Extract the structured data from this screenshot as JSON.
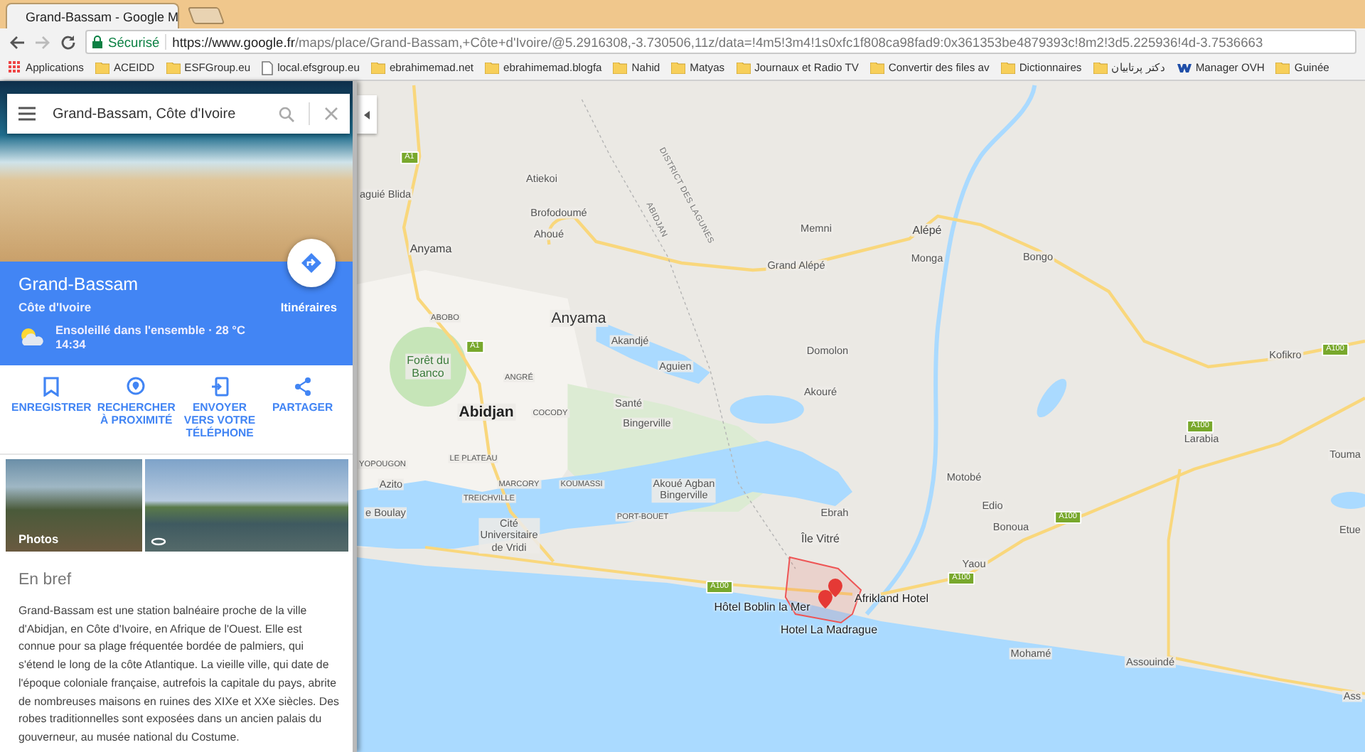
{
  "browser": {
    "tabs": [
      {
        "title": "Grand-Bassam - Google M",
        "selected": true
      }
    ],
    "address_bar": {
      "security_label": "Sécurisé",
      "url_host": "https://www.google.fr",
      "url_path": "/maps/place/Grand-Bassam,+Côte+d'Ivoire/@5.2916308,-3.730506,11z/data=!4m5!3m4!1s0xfc1f808ca98fad9:0x361353be4879393c!8m2!3d5.225936!4d-3.7536663"
    },
    "bookmarks": [
      {
        "label": "Applications",
        "kind": "apps"
      },
      {
        "label": "ACEIDD",
        "kind": "folder"
      },
      {
        "label": "ESFGroup.eu",
        "kind": "folder"
      },
      {
        "label": "local.efsgroup.eu",
        "kind": "page"
      },
      {
        "label": "ebrahimemad.net",
        "kind": "folder"
      },
      {
        "label": "ebrahimemad.blogfa",
        "kind": "folder"
      },
      {
        "label": "Nahid",
        "kind": "folder"
      },
      {
        "label": "Matyas",
        "kind": "folder"
      },
      {
        "label": "Journaux et Radio TV",
        "kind": "folder"
      },
      {
        "label": "Convertir des files av",
        "kind": "folder"
      },
      {
        "label": "Dictionnaires",
        "kind": "folder"
      },
      {
        "label": "دکتر پرتابیان",
        "kind": "folder"
      },
      {
        "label": "Manager OVH",
        "kind": "site"
      },
      {
        "label": "Guinée",
        "kind": "folder"
      }
    ]
  },
  "search": {
    "value": "Grand-Bassam, Côte d'Ivoire"
  },
  "place": {
    "name": "Grand-Bassam",
    "country": "Côte d'Ivoire",
    "weather": "Ensoleillé dans l'ensemble · 28 °C",
    "time": "14:34",
    "directions_label": "Itinéraires"
  },
  "actions": [
    {
      "label": "ENREGISTRER",
      "kind": "save"
    },
    {
      "label": "RECHERCHER À PROXIMITÉ",
      "kind": "nearby"
    },
    {
      "label": "ENVOYER VERS VOTRE TÉLÉPHONE",
      "kind": "send"
    },
    {
      "label": "PARTAGER",
      "kind": "share"
    }
  ],
  "photos": {
    "label": "Photos"
  },
  "summary": {
    "title": "En bref",
    "text": "Grand-Bassam est une station balnéaire proche de la ville d'Abidjan, en Côte d'Ivoire, en Afrique de l'Ouest. Elle est connue pour sa plage fréquentée bordée de palmiers, qui s'étend le long de la côte Atlantique. La vieille ville, qui date de l'époque coloniale française, autrefois la capitale du pays, abrite de nombreuses maisons en ruines des XIXe et XXe siècles. Des robes traditionnelles sont exposées dans un ancien palais du gouverneur, au musée national du Costume."
  },
  "map": {
    "labels": [
      {
        "text": "aguié Blida",
        "kind": "place"
      },
      {
        "text": "Atiekoi",
        "kind": "place"
      },
      {
        "text": "Brofodoumé",
        "kind": "place"
      },
      {
        "text": "Ahoué",
        "kind": "place"
      },
      {
        "text": "DISTRICT DES LAGUNES",
        "kind": "region"
      },
      {
        "text": "ABIDJAN",
        "kind": "region"
      },
      {
        "text": "Memni",
        "kind": "place"
      },
      {
        "text": "Alépé",
        "kind": "town"
      },
      {
        "text": "Grand Alépé",
        "kind": "place"
      },
      {
        "text": "Monga",
        "kind": "place"
      },
      {
        "text": "Bongo",
        "kind": "place"
      },
      {
        "text": "Anyama",
        "kind": "town"
      },
      {
        "text": "ABOBO",
        "kind": "district"
      },
      {
        "text": "Anyama",
        "kind": "city"
      },
      {
        "text": "Forêt du\nBanco",
        "kind": "park"
      },
      {
        "text": "Akandjé",
        "kind": "place"
      },
      {
        "text": "Aguien",
        "kind": "place"
      },
      {
        "text": "Domolon",
        "kind": "place"
      },
      {
        "text": "Akouré",
        "kind": "place"
      },
      {
        "text": "ANGRÉ",
        "kind": "district"
      },
      {
        "text": "Abidjan",
        "kind": "capital"
      },
      {
        "text": "COCODY",
        "kind": "district"
      },
      {
        "text": "Santé",
        "kind": "place"
      },
      {
        "text": "Kofikro",
        "kind": "place"
      },
      {
        "text": "Bingerville",
        "kind": "place"
      },
      {
        "text": "YOPOUGON",
        "kind": "district"
      },
      {
        "text": "LE PLATEAU",
        "kind": "district"
      },
      {
        "text": "Azito",
        "kind": "place"
      },
      {
        "text": "MARCORY",
        "kind": "district"
      },
      {
        "text": "KOUMASSI",
        "kind": "district"
      },
      {
        "text": "TREICHVILLE",
        "kind": "district"
      },
      {
        "text": "Akoué Agban\nBingerville",
        "kind": "place"
      },
      {
        "text": "e Boulay",
        "kind": "place"
      },
      {
        "text": "PORT-BOUET",
        "kind": "district"
      },
      {
        "text": "Cité\nUniversitaire\nde Vridi",
        "kind": "place"
      },
      {
        "text": "Ebrah",
        "kind": "place"
      },
      {
        "text": "Île Vitré",
        "kind": "town"
      },
      {
        "text": "Motobé",
        "kind": "place"
      },
      {
        "text": "Edio",
        "kind": "place"
      },
      {
        "text": "Bonoua",
        "kind": "place"
      },
      {
        "text": "Yaou",
        "kind": "place"
      },
      {
        "text": "Larabia",
        "kind": "place"
      },
      {
        "text": "Touma",
        "kind": "place"
      },
      {
        "text": "Etue",
        "kind": "place"
      },
      {
        "text": "Mohamé",
        "kind": "place"
      },
      {
        "text": "Assouindé",
        "kind": "place"
      },
      {
        "text": "Ass",
        "kind": "place"
      },
      {
        "text": "Hôtel Boblin la Mer",
        "kind": "poi"
      },
      {
        "text": "Afrikland Hotel",
        "kind": "poi"
      },
      {
        "text": "Hotel La Madrague",
        "kind": "poi"
      }
    ],
    "shields": [
      "A1",
      "A1",
      "A100",
      "A100",
      "A100",
      "A100",
      "A100"
    ]
  }
}
